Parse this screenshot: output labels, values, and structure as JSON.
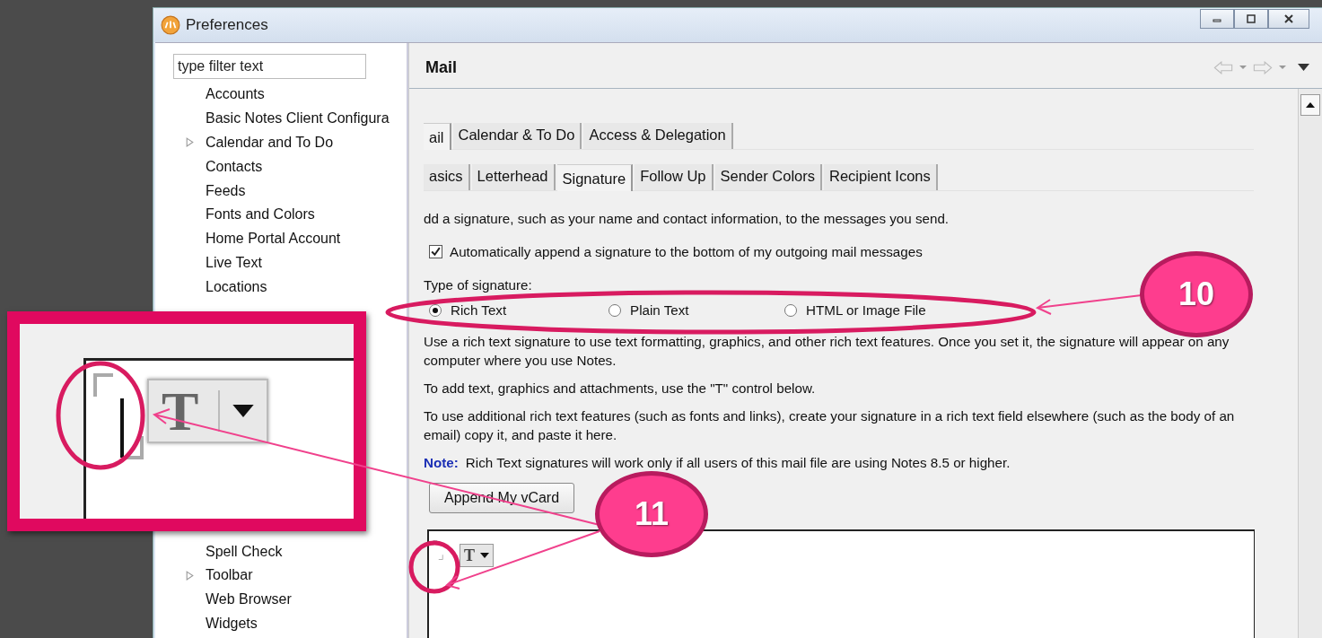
{
  "window": {
    "title": "Preferences"
  },
  "filter": {
    "placeholder": "type filter text"
  },
  "sidebar": {
    "items_top": [
      {
        "label": "Accounts",
        "kind": "leaf"
      },
      {
        "label": "Basic Notes Client Configura",
        "kind": "leaf"
      },
      {
        "label": "Calendar and To Do",
        "kind": "folder"
      },
      {
        "label": "Contacts",
        "kind": "leaf"
      },
      {
        "label": "Feeds",
        "kind": "leaf"
      },
      {
        "label": "Fonts and Colors",
        "kind": "leaf"
      },
      {
        "label": "Home Portal Account",
        "kind": "leaf"
      },
      {
        "label": "Live Text",
        "kind": "leaf"
      },
      {
        "label": "Locations",
        "kind": "leaf"
      }
    ],
    "items_bottom": [
      {
        "label": "Spell Check",
        "kind": "leaf"
      },
      {
        "label": "Toolbar",
        "kind": "folder"
      },
      {
        "label": "Web Browser",
        "kind": "leaf"
      },
      {
        "label": "Widgets",
        "kind": "leaf"
      }
    ]
  },
  "page": {
    "title": "Mail",
    "tabs": [
      {
        "label": "ail",
        "selected": true
      },
      {
        "label": "Calendar & To Do",
        "selected": false
      },
      {
        "label": "Access & Delegation",
        "selected": false
      }
    ],
    "subtabs": [
      {
        "label": "asics",
        "selected": false
      },
      {
        "label": "Letterhead",
        "selected": false
      },
      {
        "label": "Signature",
        "selected": true
      },
      {
        "label": "Follow Up",
        "selected": false
      },
      {
        "label": "Sender Colors",
        "selected": false
      },
      {
        "label": "Recipient Icons",
        "selected": false
      }
    ],
    "intro": "dd a signature, such as your name and contact information, to the messages you send.",
    "auto_append": {
      "label": "Automatically append a signature to the bottom of my outgoing mail messages",
      "checked": true
    },
    "signature_type": {
      "label": "Type of signature:",
      "options": [
        {
          "label": "Rich Text",
          "selected": true
        },
        {
          "label": "Plain Text",
          "selected": false
        },
        {
          "label": "HTML or Image File",
          "selected": false
        }
      ]
    },
    "paragraphs": [
      "Use a rich text signature to use text formatting, graphics, and other rich text features.   Once you set it, the signature will appear on any computer where you use Notes.",
      "To add text, graphics and attachments, use the \"T\" control below.",
      "To use additional rich text features (such as fonts and links), create your signature in a rich text field elsewhere (such as the body of an email) copy it, and paste it here."
    ],
    "note": {
      "label": "Note:",
      "text": "Rich Text signatures will work only if all users of this mail file are using Notes 8.5 or higher."
    },
    "vcard_button": "Append My vCard",
    "editor": {
      "button_label": "T"
    }
  },
  "inset": {
    "button_label": "T"
  },
  "callouts": [
    {
      "number": "10"
    },
    {
      "number": "11"
    }
  ]
}
